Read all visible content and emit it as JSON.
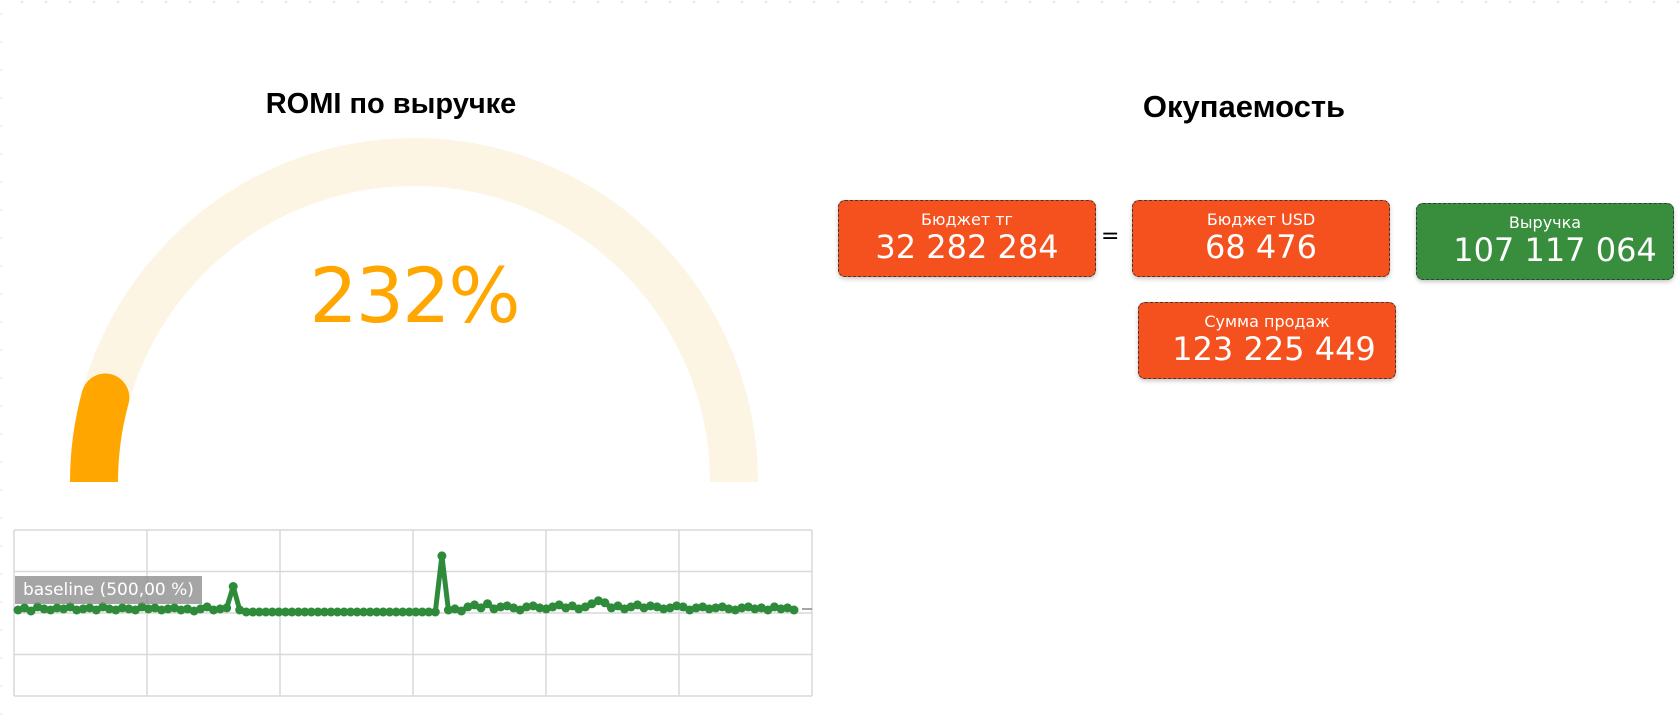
{
  "colors": {
    "gauge_fill": "#ffa600",
    "gauge_track": "#fdf5e4",
    "kpi_orange": "#f4511e",
    "kpi_green": "#388e3c",
    "spark_line": "#2e8b3a",
    "grid": "#d9d9d9"
  },
  "romi": {
    "title": "ROMI по выручке"
  },
  "payback": {
    "title": "Окупаемость",
    "equals_sign": "=",
    "cards": {
      "budget_kzt": {
        "label": "Бюджет тг",
        "value": "32 282 284"
      },
      "budget_usd": {
        "label": "Бюджет USD",
        "value": "68 476"
      },
      "revenue": {
        "label": "Выручка",
        "value": "107 117 064"
      },
      "sales_sum": {
        "label": "Сумма продаж",
        "value": "123 225 449"
      }
    }
  },
  "chart_data": [
    {
      "type": "gauge",
      "title": "ROMI по выручке",
      "value_label": "232%",
      "fill_fraction": 0.085,
      "color": "#ffa600",
      "track_color": "#fdf5e4"
    },
    {
      "type": "line",
      "baseline_label": "baseline (500,00 %)",
      "grid": true,
      "ylim": [
        0,
        1
      ],
      "x": [
        0,
        1,
        2,
        3,
        4,
        5,
        6,
        7,
        8,
        9,
        10,
        11,
        12,
        13,
        14,
        15,
        16,
        17,
        18,
        19,
        20,
        21,
        22,
        23,
        24,
        25,
        26,
        27,
        28,
        29,
        30,
        31,
        32,
        33,
        34,
        35,
        36,
        37,
        38,
        39,
        40,
        41,
        42,
        43,
        44,
        45,
        46,
        47,
        48,
        49,
        50,
        51,
        52,
        53,
        54,
        55,
        56,
        57,
        58,
        59,
        60,
        61,
        62,
        63,
        64,
        65,
        66,
        67,
        68,
        69,
        70,
        71,
        72,
        73,
        74,
        75,
        76,
        77,
        78,
        79,
        80,
        81,
        82,
        83,
        84,
        85,
        86,
        87,
        88,
        89,
        90,
        91,
        92,
        93,
        94,
        95,
        96,
        97,
        98,
        99,
        100,
        101,
        102,
        103,
        104,
        105,
        106,
        107,
        108,
        109,
        110,
        111,
        112,
        113,
        114,
        115,
        116,
        117,
        118,
        119
      ],
      "y": [
        0.02,
        0.04,
        0.01,
        0.05,
        0.03,
        0.02,
        0.04,
        0.03,
        0.05,
        0.02,
        0.03,
        0.04,
        0.02,
        0.05,
        0.03,
        0.02,
        0.04,
        0.03,
        0.02,
        0.05,
        0.03,
        0.04,
        0.02,
        0.03,
        0.04,
        0.02,
        0.03,
        0.01,
        0.03,
        0.05,
        0.02,
        0.03,
        0.04,
        0.25,
        0.02,
        0.0,
        0.0,
        0.0,
        0.0,
        0.0,
        0.0,
        0.0,
        0.0,
        0.0,
        0.0,
        0.0,
        0.0,
        0.0,
        0.0,
        0.0,
        0.0,
        0.0,
        0.0,
        0.0,
        0.0,
        0.0,
        0.0,
        0.0,
        0.0,
        0.0,
        0.0,
        0.0,
        0.0,
        0.0,
        0.0,
        0.55,
        0.02,
        0.03,
        0.01,
        0.05,
        0.07,
        0.04,
        0.08,
        0.03,
        0.05,
        0.06,
        0.04,
        0.02,
        0.05,
        0.06,
        0.04,
        0.03,
        0.05,
        0.07,
        0.04,
        0.06,
        0.03,
        0.05,
        0.08,
        0.11,
        0.09,
        0.04,
        0.06,
        0.03,
        0.05,
        0.07,
        0.04,
        0.06,
        0.05,
        0.03,
        0.04,
        0.06,
        0.05,
        0.02,
        0.04,
        0.05,
        0.03,
        0.04,
        0.05,
        0.03,
        0.02,
        0.04,
        0.05,
        0.03,
        0.04,
        0.02,
        0.05,
        0.03,
        0.04,
        0.02
      ]
    }
  ]
}
